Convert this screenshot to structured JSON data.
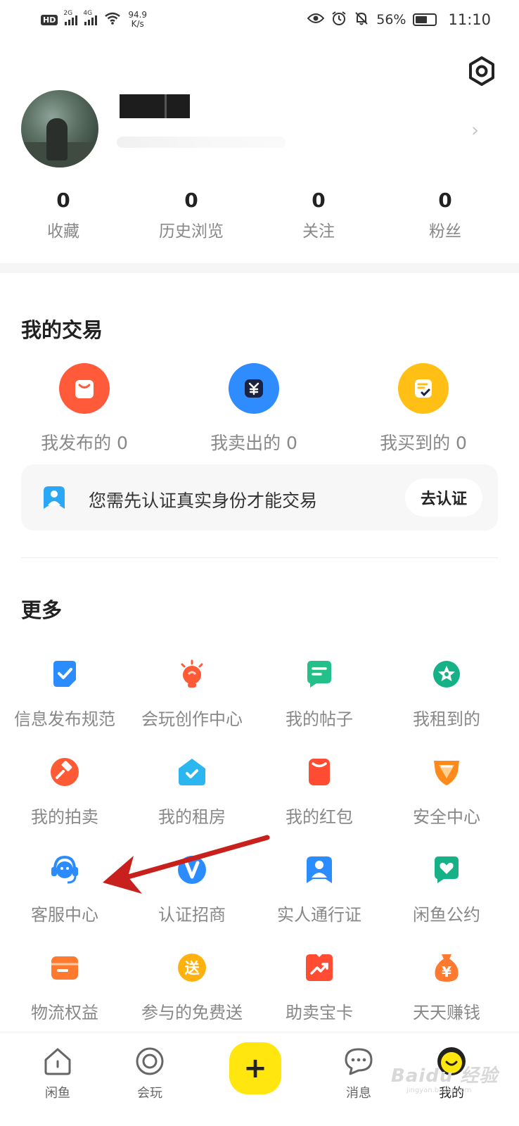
{
  "status_bar": {
    "hd": "HD",
    "sim2": "2",
    "net1": "2G",
    "net2": "4G",
    "speed_value": "94.9",
    "speed_unit": "K/s",
    "battery": "56%",
    "time": "11:10"
  },
  "profile": {
    "stats": [
      {
        "value": "0",
        "label": "收藏"
      },
      {
        "value": "0",
        "label": "历史浏览"
      },
      {
        "value": "0",
        "label": "关注"
      },
      {
        "value": "0",
        "label": "粉丝"
      }
    ]
  },
  "trade": {
    "title": "我的交易",
    "items": [
      {
        "label": "我发布的 0",
        "color": "#ff5b3b",
        "icon": "bag-icon"
      },
      {
        "label": "我卖出的 0",
        "color": "#2f8cff",
        "icon": "yuan-icon"
      },
      {
        "label": "我买到的 0",
        "color": "#ffbf14",
        "icon": "receipt-icon"
      }
    ],
    "verify_text": "您需先认证真实身份才能交易",
    "verify_button": "去认证"
  },
  "more": {
    "title": "更多",
    "items": [
      {
        "label": "信息发布规范",
        "icon": "check-doc-icon",
        "color": "#2b8cff"
      },
      {
        "label": "会玩创作中心",
        "icon": "bulb-icon",
        "color": "#ff5a36"
      },
      {
        "label": "我的帖子",
        "icon": "post-icon",
        "color": "#23c08a"
      },
      {
        "label": "我租到的",
        "icon": "star-badge-icon",
        "color": "#16b187"
      },
      {
        "label": "我的拍卖",
        "icon": "gavel-icon",
        "color": "#ff5a36"
      },
      {
        "label": "我的租房",
        "icon": "house-icon",
        "color": "#2bb6f0"
      },
      {
        "label": "我的红包",
        "icon": "red-envelope-icon",
        "color": "#ff4c33"
      },
      {
        "label": "安全中心",
        "icon": "shield-icon",
        "color": "#ff8a1c"
      },
      {
        "label": "客服中心",
        "icon": "headset-icon",
        "color": "#2b8cff"
      },
      {
        "label": "认证招商",
        "icon": "v-badge-icon",
        "color": "#2b8cff"
      },
      {
        "label": "实人通行证",
        "icon": "person-pass-icon",
        "color": "#2b8cff"
      },
      {
        "label": "闲鱼公约",
        "icon": "heart-doc-icon",
        "color": "#16b187"
      },
      {
        "label": "物流权益",
        "icon": "box-icon",
        "color": "#ff7a2e"
      },
      {
        "label": "参与的免费送",
        "icon": "gift-send-icon",
        "color": "#ffb20f",
        "glyph": "送"
      },
      {
        "label": "助卖宝卡",
        "icon": "trend-card-icon",
        "color": "#ff4c33"
      },
      {
        "label": "天天赚钱",
        "icon": "money-bag-icon",
        "color": "#ff7a2e",
        "glyph": "¥"
      }
    ]
  },
  "tab_bar": {
    "tabs": [
      {
        "label": "闲鱼"
      },
      {
        "label": "会玩"
      },
      {
        "label": "消息"
      },
      {
        "label": "我的"
      }
    ],
    "post_glyph": "+"
  },
  "watermark": {
    "text": "Baidu 经验",
    "sub": "jingyan.baidu.com"
  }
}
